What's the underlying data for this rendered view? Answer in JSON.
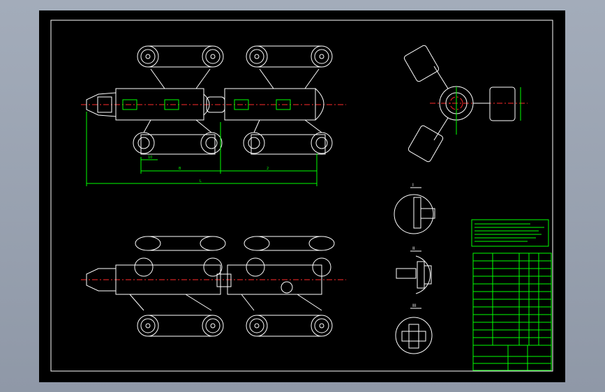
{
  "drawing": {
    "background_color": "#000000",
    "line_color": "#ffffff",
    "dimension_color": "#00ff00",
    "centerline_color": "#ff2a2a",
    "frame_color": "#ffffff"
  },
  "views": {
    "front_view": {
      "icon": "robot-top-view"
    },
    "side_view": {
      "icon": "robot-side-view"
    },
    "end_view": {
      "icon": "three-leg-end-view"
    }
  },
  "dimensions": {
    "overall_label": "L",
    "left_span_label": "B",
    "right_span_label": "2",
    "small_label": "10"
  },
  "details": [
    {
      "label": "I"
    },
    {
      "label": "II"
    },
    {
      "label": "III"
    }
  ]
}
